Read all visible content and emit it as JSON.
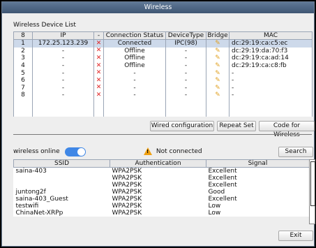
{
  "window": {
    "title": "Wireless"
  },
  "device_list": {
    "title": "Wireless Device List",
    "columns": [
      "8",
      "IP",
      "-",
      "Connection Status",
      "DeviceType",
      "Bridge",
      "MAC"
    ],
    "rows": [
      {
        "num": "1",
        "ip": "172.25.123.239",
        "status": "Connected",
        "type": "IPC(98)",
        "mac": "dc:29:19:ca:c5:ec"
      },
      {
        "num": "2",
        "ip": "-",
        "status": "Offline",
        "type": "-",
        "mac": "dc:29:19:da:70:f3"
      },
      {
        "num": "3",
        "ip": "-",
        "status": "Offline",
        "type": "-",
        "mac": "dc:29:19:ca:ad:14"
      },
      {
        "num": "4",
        "ip": "-",
        "status": "Offline",
        "type": "-",
        "mac": "dc:29:19:ca:c8:fb"
      },
      {
        "num": "5",
        "ip": "-",
        "status": "-",
        "type": "-",
        "mac": "-"
      },
      {
        "num": "6",
        "ip": "-",
        "status": "-",
        "type": "-",
        "mac": "-"
      },
      {
        "num": "7",
        "ip": "-",
        "status": "-",
        "type": "-",
        "mac": "-"
      },
      {
        "num": "8",
        "ip": "-",
        "status": "-",
        "type": "-",
        "mac": "-"
      }
    ]
  },
  "buttons": {
    "wired_config": "Wired configuration",
    "repeat_set": "Repeat Set",
    "code_for_wireless": "Code for Wireless",
    "search": "Search",
    "exit": "Exit"
  },
  "wireless_online": {
    "label": "wireless online",
    "enabled": true
  },
  "status": {
    "text": "Not connected",
    "color": "#f0a010"
  },
  "wifi_list": {
    "columns": [
      "SSID",
      "Authentication",
      "Signal"
    ],
    "rows": [
      {
        "ssid": "saina-403",
        "auth": "WPA2PSK",
        "signal": "Excellent"
      },
      {
        "ssid": "",
        "auth": "WPA2PSK",
        "signal": "Excellent"
      },
      {
        "ssid": "",
        "auth": "WPA2PSK",
        "signal": "Excellent"
      },
      {
        "ssid": "juntong2f",
        "auth": "WPA2PSK",
        "signal": "Good"
      },
      {
        "ssid": "saina-403_Guest",
        "auth": "WPA2PSK",
        "signal": "Excellent"
      },
      {
        "ssid": "testwifi",
        "auth": "WPA2PSK",
        "signal": "Low"
      },
      {
        "ssid": "ChinaNet-XRPp",
        "auth": "WPA2PSK",
        "signal": "Low"
      }
    ]
  }
}
